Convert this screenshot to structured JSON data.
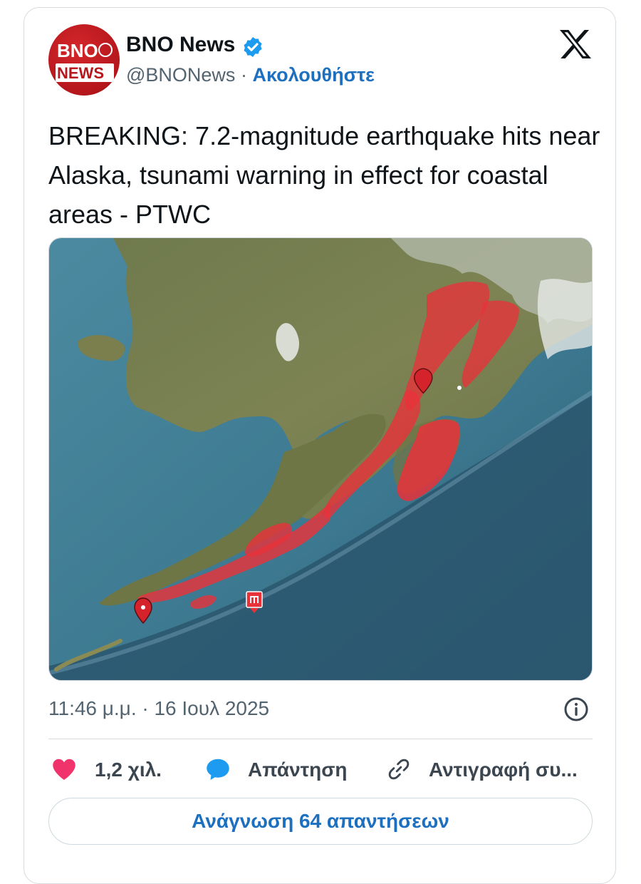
{
  "author": {
    "avatar_top": "BNO",
    "avatar_bottom": "NEWS",
    "name": "BNO News",
    "handle": "@BNONews",
    "separator": "·",
    "follow_label": "Ακολουθήστε"
  },
  "tweet": {
    "text": "BREAKING: 7.2-magnitude earthquake hits near Alaska, tsunami warning in effect for coastal areas - PTWC",
    "timestamp": "11:46 μ.μ. · 16 Ιουλ 2025"
  },
  "actions": {
    "likes_count": "1,2 χιλ.",
    "reply_label": "Απάντηση",
    "copy_label": "Αντιγραφή συ..."
  },
  "replies_button_label": "Ανάγνωση 64 απαντήσεων",
  "colors": {
    "accent": "#1d6fbf",
    "like": "#f0336b",
    "reply": "#1d9bf0",
    "warning_zone": "#e8323a",
    "ocean": "#3f7890"
  },
  "icons": [
    "verified-badge-icon",
    "x-logo-icon",
    "info-icon",
    "heart-icon",
    "reply-bubble-icon",
    "link-icon",
    "map-pin-icon",
    "tsunami-warning-icon"
  ]
}
